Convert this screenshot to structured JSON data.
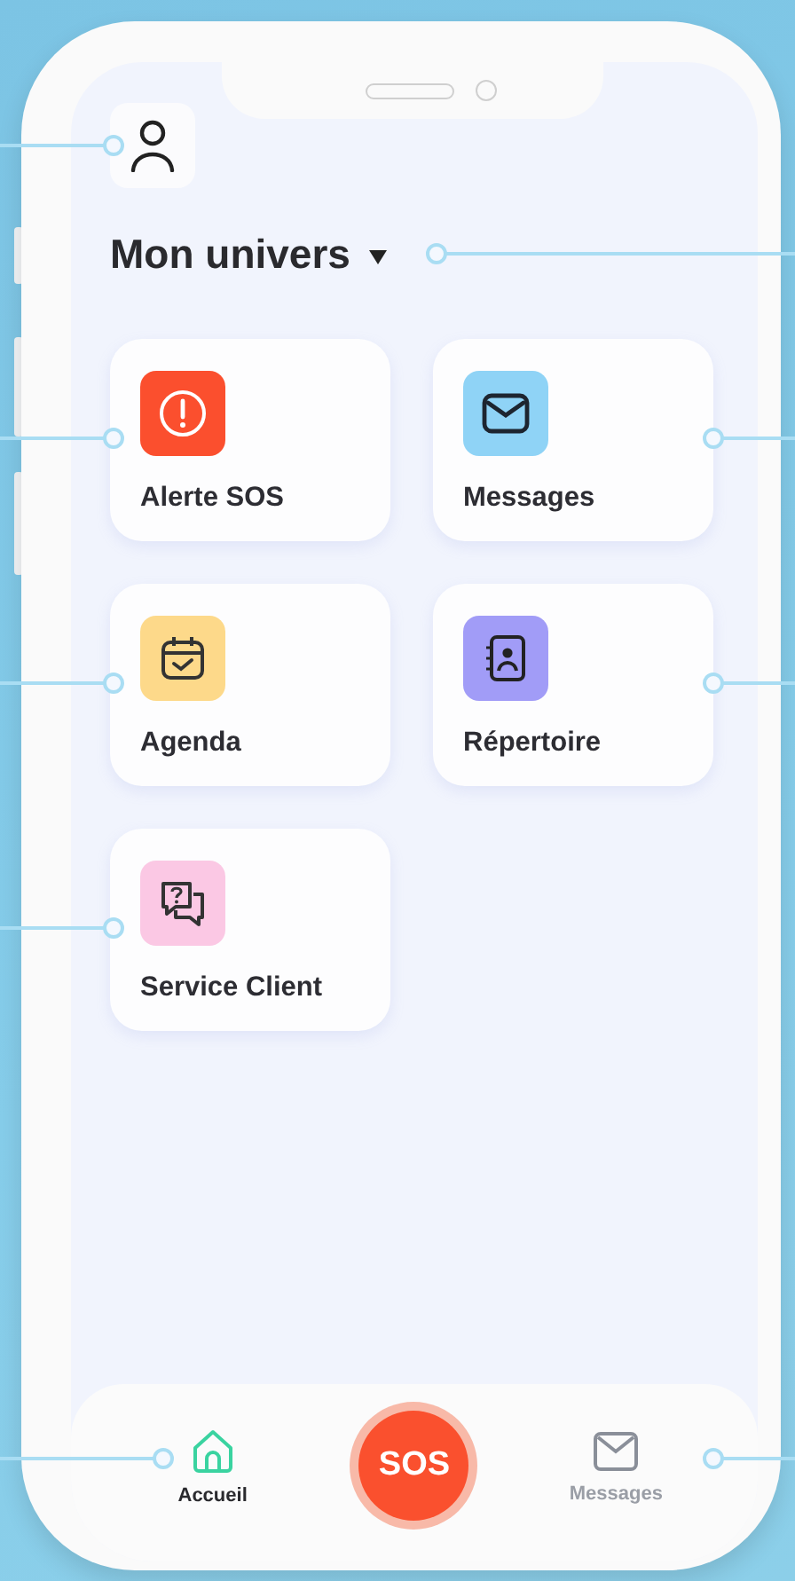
{
  "header": {
    "title": "Mon univers"
  },
  "tiles": [
    {
      "label": "Alerte SOS",
      "kind": "alert",
      "color": "#fb4f2e"
    },
    {
      "label": "Messages",
      "kind": "mail",
      "color": "#8fd3f6"
    },
    {
      "label": "Agenda",
      "kind": "calendar",
      "color": "#fdd98a"
    },
    {
      "label": "Répertoire",
      "kind": "contacts",
      "color": "#a19cf7"
    },
    {
      "label": "Service Client",
      "kind": "help",
      "color": "#fbc8e4"
    }
  ],
  "nav": {
    "items": [
      {
        "label": "Accueil",
        "kind": "home",
        "selected": true
      },
      {
        "label": "Messages",
        "kind": "mail",
        "selected": false
      }
    ],
    "sos_button": {
      "label": "SOS"
    }
  }
}
